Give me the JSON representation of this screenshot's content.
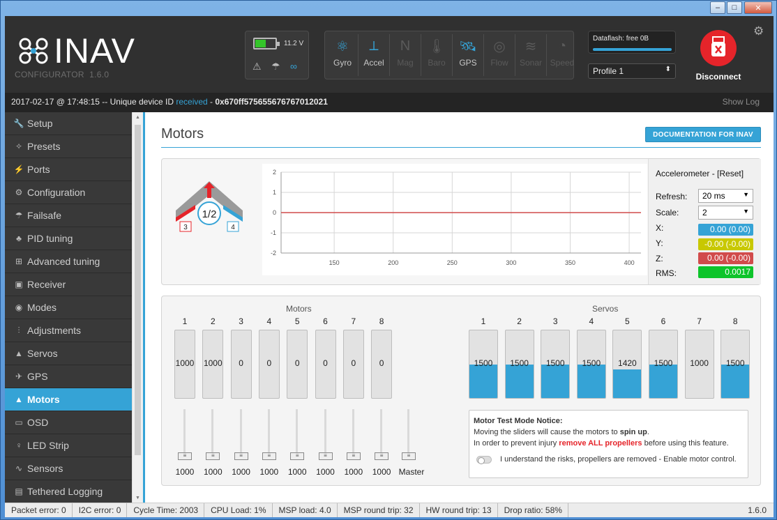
{
  "app": {
    "name": "INAV",
    "subtitle": "CONFIGURATOR",
    "version": "1.6.0"
  },
  "window_controls": {
    "minimize": "–",
    "maximize": "□",
    "close": "✕"
  },
  "battery": {
    "voltage": "11.2 V",
    "level": 0.55,
    "color": "#34c52a"
  },
  "sensors": [
    {
      "label": "Gyro",
      "icon": "gyro-icon",
      "active": true
    },
    {
      "label": "Accel",
      "icon": "accel-icon",
      "active": true
    },
    {
      "label": "Mag",
      "icon": "mag-icon",
      "active": false
    },
    {
      "label": "Baro",
      "icon": "baro-icon",
      "active": false
    },
    {
      "label": "GPS",
      "icon": "gps-icon",
      "active": true
    },
    {
      "label": "Flow",
      "icon": "flow-icon",
      "active": false
    },
    {
      "label": "Sonar",
      "icon": "sonar-icon",
      "active": false
    },
    {
      "label": "Speed",
      "icon": "speed-icon",
      "active": false
    }
  ],
  "dataflash": {
    "label": "Dataflash: free 0B",
    "used_fraction": 1.0
  },
  "profile": {
    "selected": "Profile 1"
  },
  "disconnect": {
    "label": "Disconnect"
  },
  "status_bar": {
    "timestamp": "2017-02-17 @ 17:48:15",
    "sep": " -- Unique device ID ",
    "received": "received",
    "dash": " - ",
    "device_id": "0x670ff575655676767012021",
    "show_log": "Show Log"
  },
  "sidebar": {
    "items": [
      {
        "label": "Setup",
        "icon": "wrench-icon",
        "glyph": "🔧"
      },
      {
        "label": "Presets",
        "icon": "presets-icon",
        "glyph": "✧"
      },
      {
        "label": "Ports",
        "icon": "plug-icon",
        "glyph": "⚡"
      },
      {
        "label": "Configuration",
        "icon": "gear-icon",
        "glyph": "⚙"
      },
      {
        "label": "Failsafe",
        "icon": "parachute-icon",
        "glyph": "☂"
      },
      {
        "label": "PID tuning",
        "icon": "pid-icon",
        "glyph": "♣"
      },
      {
        "label": "Advanced tuning",
        "icon": "advanced-icon",
        "glyph": "⊞"
      },
      {
        "label": "Receiver",
        "icon": "receiver-icon",
        "glyph": "▣"
      },
      {
        "label": "Modes",
        "icon": "modes-icon",
        "glyph": "◉"
      },
      {
        "label": "Adjustments",
        "icon": "adjustments-icon",
        "glyph": "⫶"
      },
      {
        "label": "Servos",
        "icon": "servo-icon",
        "glyph": "▲"
      },
      {
        "label": "GPS",
        "icon": "satellite-icon",
        "glyph": "✈"
      },
      {
        "label": "Motors",
        "icon": "motor-icon",
        "glyph": "▲",
        "active": true
      },
      {
        "label": "OSD",
        "icon": "osd-icon",
        "glyph": "▭"
      },
      {
        "label": "LED Strip",
        "icon": "led-icon",
        "glyph": "♀"
      },
      {
        "label": "Sensors",
        "icon": "sensors-icon",
        "glyph": "∿"
      },
      {
        "label": "Tethered Logging",
        "icon": "logging-icon",
        "glyph": "▤"
      }
    ]
  },
  "page": {
    "title": "Motors",
    "doc_button": "DOCUMENTATION FOR INAV"
  },
  "mixer": {
    "center_label": "1/2",
    "left_label": "3",
    "right_label": "4"
  },
  "accelerometer": {
    "title": "Accelerometer - [Reset]",
    "refresh_label": "Refresh:",
    "refresh_value": "20 ms",
    "scale_label": "Scale:",
    "scale_value": "2",
    "x_label": "X:",
    "x_value": "0.00 (0.00)",
    "x_color": "#35a3d6",
    "y_label": "Y:",
    "y_value": "-0.00 (-0.00)",
    "y_color": "#c8c800",
    "z_label": "Z:",
    "z_value": "0.00 (-0.00)",
    "z_color": "#d14b4b",
    "rms_label": "RMS:",
    "rms_value": "0.0017",
    "rms_color": "#0ec42b"
  },
  "chart_data": {
    "type": "line",
    "title": "",
    "xlabel": "",
    "ylabel": "",
    "x_ticks": [
      "150",
      "200",
      "250",
      "300",
      "350",
      "400"
    ],
    "y_ticks": [
      "2",
      "1",
      "0",
      "-1",
      "-2"
    ],
    "xlim": [
      105,
      410
    ],
    "ylim": [
      -2,
      2
    ],
    "grid": true,
    "series": [
      {
        "color": "#d14b4b",
        "x": [
          105,
          410
        ],
        "y": [
          0,
          0
        ]
      }
    ]
  },
  "motors": {
    "heading": "Motors",
    "numbers": [
      "1",
      "2",
      "3",
      "4",
      "5",
      "6",
      "7",
      "8"
    ],
    "values": [
      "1000",
      "1000",
      "0",
      "0",
      "0",
      "0",
      "0",
      "0"
    ],
    "slider_values": [
      "1000",
      "1000",
      "1000",
      "1000",
      "1000",
      "1000",
      "1000",
      "1000"
    ],
    "master_label": "Master"
  },
  "servos": {
    "heading": "Servos",
    "numbers": [
      "1",
      "2",
      "3",
      "4",
      "5",
      "6",
      "7",
      "8"
    ],
    "values": [
      "1500",
      "1500",
      "1500",
      "1500",
      "1420",
      "1500",
      "1000",
      "1500"
    ],
    "fill_fraction": [
      0.5,
      0.5,
      0.5,
      0.5,
      0.42,
      0.5,
      0.0,
      0.5
    ]
  },
  "notice": {
    "title": "Motor Test Mode Notice:",
    "line1a": "Moving the sliders will cause the motors to ",
    "line1b": "spin up",
    "line1c": ".",
    "line2a": "In order to prevent injury ",
    "line2b": "remove ALL propellers",
    "line2c": " before using this feature.",
    "toggle_label": "I understand the risks, propellers are removed - Enable motor control."
  },
  "footer": {
    "packet_error": "Packet error: 0",
    "i2c_error": "I2C error: 0",
    "cycle_time": "Cycle Time: 2003",
    "cpu_load": "CPU Load: 1%",
    "msp_load": "MSP load: 4.0",
    "msp_round_trip": "MSP round trip: 32",
    "hw_round_trip": "HW round trip: 13",
    "drop_ratio": "Drop ratio: 58%",
    "version": "1.6.0"
  }
}
